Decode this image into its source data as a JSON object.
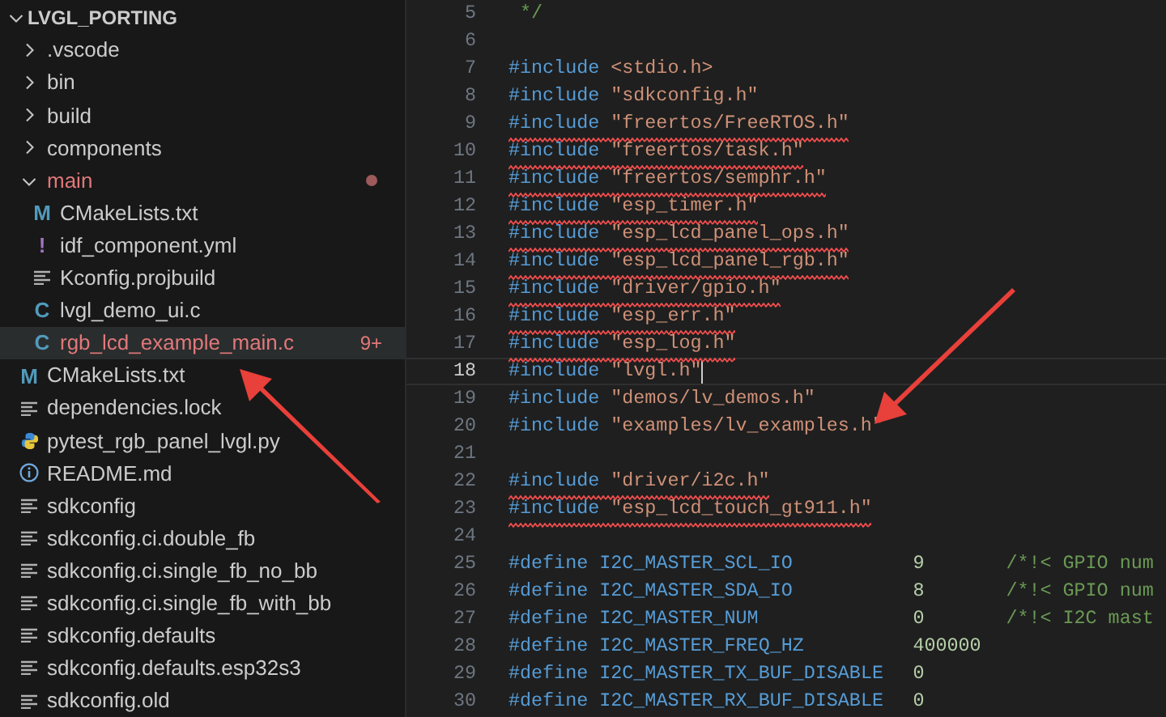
{
  "explorer": {
    "root": {
      "label": "LVGL_PORTING",
      "expanded": true
    },
    "items": [
      {
        "kind": "folder",
        "label": ".vscode",
        "expanded": false,
        "modified": false,
        "selected": false
      },
      {
        "kind": "folder",
        "label": "bin",
        "expanded": false,
        "modified": false,
        "selected": false
      },
      {
        "kind": "folder",
        "label": "build",
        "expanded": false,
        "modified": false,
        "selected": false
      },
      {
        "kind": "folder",
        "label": "components",
        "expanded": false,
        "modified": false,
        "selected": false
      },
      {
        "kind": "folder",
        "label": "main",
        "expanded": true,
        "modified": true,
        "selected": false,
        "children": [
          {
            "kind": "cmake",
            "glyph": "M",
            "label": "CMakeLists.txt",
            "modified": false,
            "selected": false
          },
          {
            "kind": "yaml",
            "glyph": "!",
            "label": "idf_component.yml",
            "modified": false,
            "selected": false
          },
          {
            "kind": "text",
            "label": "Kconfig.projbuild",
            "modified": false,
            "selected": false
          },
          {
            "kind": "c",
            "glyph": "C",
            "label": "lvgl_demo_ui.c",
            "modified": false,
            "selected": false
          },
          {
            "kind": "c",
            "glyph": "C",
            "label": "rgb_lcd_example_main.c",
            "modified": true,
            "badge": "9+",
            "selected": true
          }
        ]
      },
      {
        "kind": "cmake",
        "glyph": "M",
        "label": "CMakeLists.txt",
        "modified": false,
        "selected": false
      },
      {
        "kind": "text",
        "label": "dependencies.lock",
        "modified": false,
        "selected": false
      },
      {
        "kind": "python",
        "label": "pytest_rgb_panel_lvgl.py",
        "modified": false,
        "selected": false
      },
      {
        "kind": "info",
        "label": "README.md",
        "modified": false,
        "selected": false
      },
      {
        "kind": "text",
        "label": "sdkconfig",
        "modified": false,
        "selected": false
      },
      {
        "kind": "text",
        "label": "sdkconfig.ci.double_fb",
        "modified": false,
        "selected": false
      },
      {
        "kind": "text",
        "label": "sdkconfig.ci.single_fb_no_bb",
        "modified": false,
        "selected": false
      },
      {
        "kind": "text",
        "label": "sdkconfig.ci.single_fb_with_bb",
        "modified": false,
        "selected": false
      },
      {
        "kind": "text",
        "label": "sdkconfig.defaults",
        "modified": false,
        "selected": false
      },
      {
        "kind": "text",
        "label": "sdkconfig.defaults.esp32s3",
        "modified": false,
        "selected": false
      },
      {
        "kind": "text",
        "label": "sdkconfig.old",
        "modified": false,
        "selected": false
      }
    ]
  },
  "editor": {
    "lines": [
      {
        "number": "5",
        "parts": [
          {
            "kind": "comment",
            "text": " */"
          }
        ],
        "squiggle": false,
        "current": false
      },
      {
        "number": "6",
        "current": false
      },
      {
        "number": "7",
        "parts": [
          {
            "kind": "keyword",
            "text": "#include"
          },
          {
            "kind": "string",
            "text": "<stdio.h>"
          }
        ],
        "squiggle": false,
        "current": false
      },
      {
        "number": "8",
        "parts": [
          {
            "kind": "keyword",
            "text": "#include"
          },
          {
            "kind": "string",
            "text": "\"sdkconfig.h\""
          }
        ],
        "squiggle": false,
        "current": false
      },
      {
        "number": "9",
        "parts": [
          {
            "kind": "keyword",
            "text": "#include"
          },
          {
            "kind": "string",
            "text": "\"freertos/FreeRTOS.h\""
          }
        ],
        "squiggle": true,
        "current": false
      },
      {
        "number": "10",
        "parts": [
          {
            "kind": "keyword",
            "text": "#include"
          },
          {
            "kind": "string",
            "text": "\"freertos/task.h\""
          }
        ],
        "squiggle": true,
        "current": false
      },
      {
        "number": "11",
        "parts": [
          {
            "kind": "keyword",
            "text": "#include"
          },
          {
            "kind": "string",
            "text": "\"freertos/semphr.h\""
          }
        ],
        "squiggle": true,
        "current": false
      },
      {
        "number": "12",
        "parts": [
          {
            "kind": "keyword",
            "text": "#include"
          },
          {
            "kind": "string",
            "text": "\"esp_timer.h\""
          }
        ],
        "squiggle": true,
        "current": false
      },
      {
        "number": "13",
        "parts": [
          {
            "kind": "keyword",
            "text": "#include"
          },
          {
            "kind": "string",
            "text": "\"esp_lcd_panel_ops.h\""
          }
        ],
        "squiggle": true,
        "current": false
      },
      {
        "number": "14",
        "parts": [
          {
            "kind": "keyword",
            "text": "#include"
          },
          {
            "kind": "string",
            "text": "\"esp_lcd_panel_rgb.h\""
          }
        ],
        "squiggle": true,
        "current": false
      },
      {
        "number": "15",
        "parts": [
          {
            "kind": "keyword",
            "text": "#include"
          },
          {
            "kind": "string",
            "text": "\"driver/gpio.h\""
          }
        ],
        "squiggle": true,
        "current": false
      },
      {
        "number": "16",
        "parts": [
          {
            "kind": "keyword",
            "text": "#include"
          },
          {
            "kind": "string",
            "text": "\"esp_err.h\""
          }
        ],
        "squiggle": true,
        "current": false
      },
      {
        "number": "17",
        "parts": [
          {
            "kind": "keyword",
            "text": "#include"
          },
          {
            "kind": "string",
            "text": "\"esp_log.h\""
          }
        ],
        "squiggle": true,
        "current": false
      },
      {
        "number": "18",
        "parts": [
          {
            "kind": "keyword",
            "text": "#include"
          },
          {
            "kind": "string",
            "text": "\"lvgl.h\""
          }
        ],
        "squiggle": false,
        "current": true
      },
      {
        "number": "19",
        "parts": [
          {
            "kind": "keyword",
            "text": "#include"
          },
          {
            "kind": "string",
            "text": "\"demos/lv_demos.h\""
          }
        ],
        "squiggle": false,
        "current": false
      },
      {
        "number": "20",
        "parts": [
          {
            "kind": "keyword",
            "text": "#include"
          },
          {
            "kind": "string",
            "text": "\"examples/lv_examples.h\""
          }
        ],
        "squiggle": false,
        "current": false
      },
      {
        "number": "21",
        "current": false
      },
      {
        "number": "22",
        "parts": [
          {
            "kind": "keyword",
            "text": "#include"
          },
          {
            "kind": "string",
            "text": "\"driver/i2c.h\""
          }
        ],
        "squiggle": true,
        "current": false
      },
      {
        "number": "23",
        "parts": [
          {
            "kind": "keyword",
            "text": "#include"
          },
          {
            "kind": "string",
            "text": "\"esp_lcd_touch_gt911.h\""
          }
        ],
        "squiggle": true,
        "current": false
      },
      {
        "number": "24",
        "current": false
      },
      {
        "number": "25",
        "parts": [
          {
            "kind": "keyword",
            "text": "#define"
          },
          {
            "kind": "macro",
            "text": "I2C_MASTER_SCL_IO"
          },
          {
            "kind": "number",
            "text": "9"
          },
          {
            "kind": "comment",
            "text": "/*!< GPIO num"
          }
        ],
        "squiggle": false,
        "current": false
      },
      {
        "number": "26",
        "parts": [
          {
            "kind": "keyword",
            "text": "#define"
          },
          {
            "kind": "macro",
            "text": "I2C_MASTER_SDA_IO"
          },
          {
            "kind": "number",
            "text": "8"
          },
          {
            "kind": "comment",
            "text": "/*!< GPIO num"
          }
        ],
        "squiggle": false,
        "current": false
      },
      {
        "number": "27",
        "parts": [
          {
            "kind": "keyword",
            "text": "#define"
          },
          {
            "kind": "macro",
            "text": "I2C_MASTER_NUM"
          },
          {
            "kind": "number",
            "text": "0"
          },
          {
            "kind": "comment",
            "text": "/*!< I2C mast"
          }
        ],
        "squiggle": false,
        "current": false
      },
      {
        "number": "28",
        "parts": [
          {
            "kind": "keyword",
            "text": "#define"
          },
          {
            "kind": "macro",
            "text": "I2C_MASTER_FREQ_HZ"
          },
          {
            "kind": "number",
            "text": "400000"
          }
        ],
        "squiggle": false,
        "current": false
      },
      {
        "number": "29",
        "parts": [
          {
            "kind": "keyword",
            "text": "#define"
          },
          {
            "kind": "macro",
            "text": "I2C_MASTER_TX_BUF_DISABLE"
          },
          {
            "kind": "number",
            "text": "0"
          }
        ],
        "squiggle": false,
        "current": false
      },
      {
        "number": "30",
        "parts": [
          {
            "kind": "keyword",
            "text": "#define"
          },
          {
            "kind": "macro",
            "text": "I2C_MASTER_RX_BUF_DISABLE"
          },
          {
            "kind": "number",
            "text": "0"
          }
        ],
        "squiggle": false,
        "current": false
      }
    ]
  }
}
